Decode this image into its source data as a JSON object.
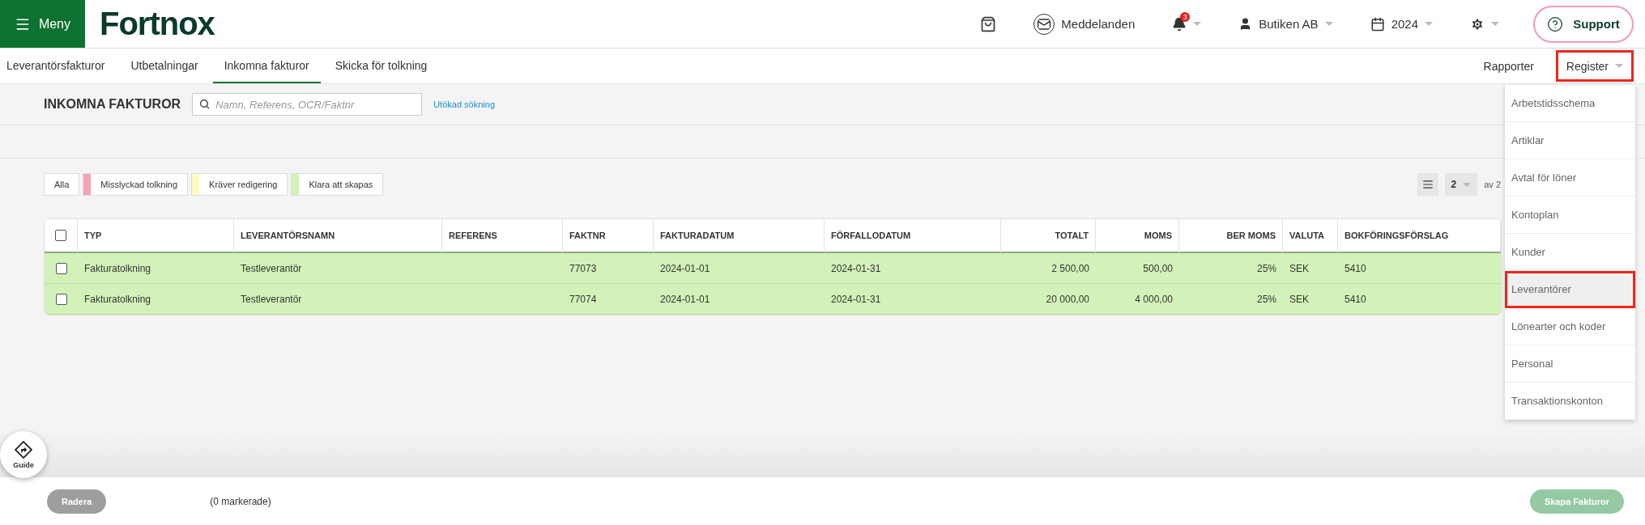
{
  "topbar": {
    "menu_label": "Meny",
    "logo": "Fortnox",
    "messages": "Meddelanden",
    "notifications_count": "3",
    "company": "Butiken AB",
    "year": "2024",
    "support": "Support"
  },
  "tabs": [
    {
      "label": "Leverantörsfakturor",
      "selected": false
    },
    {
      "label": "Utbetalningar",
      "selected": false
    },
    {
      "label": "Inkomna fakturor",
      "selected": true
    },
    {
      "label": "Skicka för tolkning",
      "selected": false
    }
  ],
  "right_tabs": [
    {
      "label": "Rapporter",
      "has_menu": false,
      "highlighted": false
    },
    {
      "label": "Register",
      "has_menu": true,
      "highlighted": true
    }
  ],
  "register_menu": [
    {
      "label": "Arbetstidsschema",
      "highlighted": false
    },
    {
      "label": "Artiklar",
      "highlighted": false
    },
    {
      "label": "Avtal för löner",
      "highlighted": false
    },
    {
      "label": "Kontoplan",
      "highlighted": false
    },
    {
      "label": "Kunder",
      "highlighted": false
    },
    {
      "label": "Leverantörer",
      "highlighted": true
    },
    {
      "label": "Lönearter och koder",
      "highlighted": false
    },
    {
      "label": "Personal",
      "highlighted": false
    },
    {
      "label": "Transaktionskonton",
      "highlighted": false
    }
  ],
  "page": {
    "title": "INKOMNA FAKTUROR",
    "search_placeholder": "Namn, Referens, OCR/Faktnr",
    "advanced_search": "Utökad sökning"
  },
  "filters": [
    {
      "label": "Alla"
    },
    {
      "label": "Misslyckad tolkning",
      "color": "#f4a3b5"
    },
    {
      "label": "Kräver redigering",
      "color": "#fdf8c4"
    },
    {
      "label": "Klara att skapas",
      "color": "#d3f2b9"
    }
  ],
  "pagination": {
    "page": "2",
    "total": "av 2"
  },
  "table": {
    "all_checked": false,
    "columns": [
      {
        "label": "TYP",
        "numeric": false
      },
      {
        "label": "LEVERANTÖRSNAMN",
        "numeric": false
      },
      {
        "label": "REFERENS",
        "numeric": false
      },
      {
        "label": "FAKTNR",
        "numeric": false
      },
      {
        "label": "FAKTURADATUM",
        "numeric": false
      },
      {
        "label": "FÖRFALLODATUM",
        "numeric": false
      },
      {
        "label": "TOTALT",
        "numeric": true
      },
      {
        "label": "MOMS",
        "numeric": true
      },
      {
        "label": "BER MOMS",
        "numeric": true
      },
      {
        "label": "VALUTA",
        "numeric": false
      },
      {
        "label": "BOKFÖRINGSFÖRSLAG",
        "numeric": false
      }
    ],
    "rows": [
      {
        "checked": false,
        "cells": [
          "Fakturatolkning",
          "Testleverantör",
          "",
          "77073",
          "2024-01-01",
          "2024-01-31",
          "2 500,00",
          "500,00",
          "25%",
          "SEK",
          "5410"
        ]
      },
      {
        "checked": false,
        "cells": [
          "Fakturatolkning",
          "Testleverantör",
          "",
          "77074",
          "2024-01-01",
          "2024-01-31",
          "20 000,00",
          "4 000,00",
          "25%",
          "SEK",
          "5410"
        ]
      }
    ]
  },
  "footer": {
    "delete": {
      "label": "Radera",
      "disabled": true
    },
    "selected_count": "(0 markerade)",
    "create": {
      "label": "Skapa Fakturor",
      "disabled": true
    },
    "guide": "Guide"
  }
}
